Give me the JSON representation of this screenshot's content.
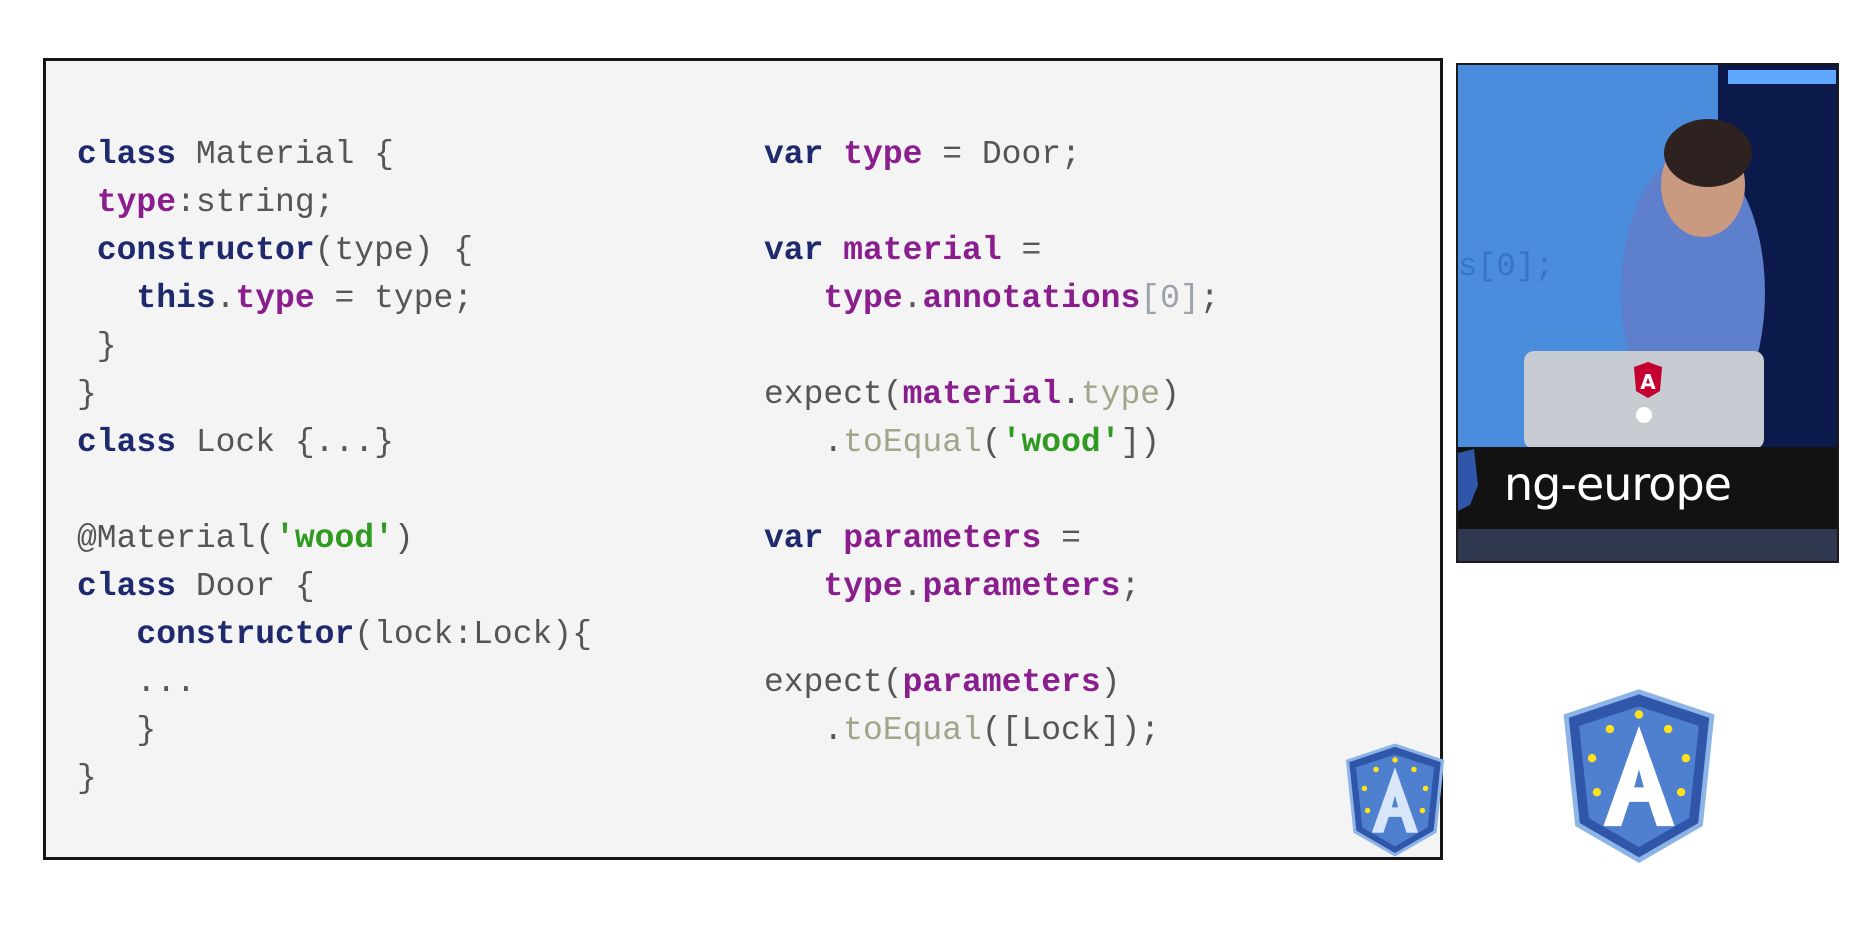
{
  "colors": {
    "keyword": "#1f2a6e",
    "property": "#8a1e8e",
    "string": "#2e9a1f",
    "method": "#a3a58a",
    "plain": "#555555",
    "badge_blue": "#2f56a8",
    "badge_light": "#9fc4ee",
    "star": "#ffe21a"
  },
  "slide": {
    "left_code": [
      [
        [
          "kw",
          "class"
        ],
        [
          "pl",
          " Material {"
        ]
      ],
      [
        [
          "pl",
          " "
        ],
        [
          "pr",
          "type"
        ],
        [
          "pl",
          ":string;"
        ]
      ],
      [
        [
          "pl",
          " "
        ],
        [
          "kw",
          "constructor"
        ],
        [
          "pl",
          "(type) {"
        ]
      ],
      [
        [
          "pl",
          "   "
        ],
        [
          "kw",
          "this"
        ],
        [
          "pl",
          "."
        ],
        [
          "pr",
          "type"
        ],
        [
          "pl",
          " = type;"
        ]
      ],
      [
        [
          "pl",
          " }"
        ]
      ],
      [
        [
          "pl",
          "}"
        ]
      ],
      [
        [
          "kw",
          "class"
        ],
        [
          "pl",
          " Lock {...}"
        ]
      ],
      [],
      [
        [
          "pl",
          "@Material("
        ],
        [
          "st",
          "'wood'"
        ],
        [
          "pl",
          ")"
        ]
      ],
      [
        [
          "kw",
          "class"
        ],
        [
          "pl",
          " Door {"
        ]
      ],
      [
        [
          "pl",
          "   "
        ],
        [
          "kw",
          "constructor"
        ],
        [
          "pl",
          "(lock:Lock){"
        ]
      ],
      [
        [
          "pl",
          "   ..."
        ]
      ],
      [
        [
          "pl",
          "   }"
        ]
      ],
      [
        [
          "pl",
          "}"
        ]
      ]
    ],
    "right_code": [
      [
        [
          "kw",
          "var"
        ],
        [
          "pl",
          " "
        ],
        [
          "pr",
          "type"
        ],
        [
          "pl",
          " = Door;"
        ]
      ],
      [],
      [
        [
          "kw",
          "var"
        ],
        [
          "pl",
          " "
        ],
        [
          "pr",
          "material"
        ],
        [
          "pl",
          " ="
        ]
      ],
      [
        [
          "pl",
          "   "
        ],
        [
          "pr",
          "type"
        ],
        [
          "pl",
          "."
        ],
        [
          "pr",
          "annotations"
        ],
        [
          "mu",
          "[0]"
        ],
        [
          "pl",
          ";"
        ]
      ],
      [],
      [
        [
          "pl",
          "expect("
        ],
        [
          "pr",
          "material"
        ],
        [
          "pl",
          "."
        ],
        [
          "fn",
          "type"
        ],
        [
          "pl",
          ")"
        ]
      ],
      [
        [
          "pl",
          "   ."
        ],
        [
          "fn",
          "toEqual"
        ],
        [
          "pl",
          "("
        ],
        [
          "st",
          "'wood'"
        ],
        [
          "pl",
          "])"
        ]
      ],
      [],
      [
        [
          "kw",
          "var"
        ],
        [
          "pl",
          " "
        ],
        [
          "pr",
          "parameters"
        ],
        [
          "pl",
          " ="
        ]
      ],
      [
        [
          "pl",
          "   "
        ],
        [
          "pr",
          "type"
        ],
        [
          "pl",
          "."
        ],
        [
          "pr",
          "parameters"
        ],
        [
          "pl",
          ";"
        ]
      ],
      [],
      [
        [
          "pl",
          "expect("
        ],
        [
          "pr",
          "parameters"
        ],
        [
          "pl",
          ")"
        ]
      ],
      [
        [
          "pl",
          "   ."
        ],
        [
          "fn",
          "toEqual"
        ],
        [
          "pl",
          "([Lock]);"
        ]
      ]
    ]
  },
  "video": {
    "label": "ng-europe",
    "icons": [
      "angular-logo-icon",
      "apple-logo-icon"
    ]
  },
  "badges": [
    "ng-europe-shield-icon",
    "ng-europe-shield-icon"
  ]
}
